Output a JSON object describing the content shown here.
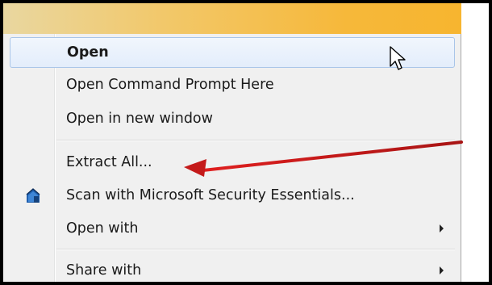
{
  "menu": {
    "items": [
      {
        "label": "Open"
      },
      {
        "label": "Open Command Prompt Here"
      },
      {
        "label": "Open in new window"
      },
      {
        "label": "Extract All..."
      },
      {
        "label": "Scan with Microsoft Security Essentials..."
      },
      {
        "label": "Open with"
      },
      {
        "label": "Share with"
      }
    ]
  },
  "colors": {
    "annotation_arrow": "#c41a1a",
    "highlight_border": "#a9c5e8",
    "title_strip": "#f6b83a"
  },
  "icons": {
    "security_essentials": "microsoft-security-essentials-icon",
    "cursor": "mouse-pointer-icon",
    "submenu": "submenu-arrow-icon"
  }
}
